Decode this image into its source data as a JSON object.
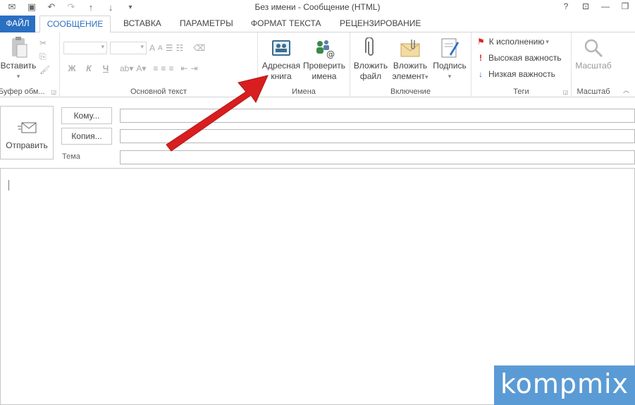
{
  "window": {
    "title": "Без имени - Сообщение (HTML)",
    "controls": [
      "?",
      "⊡",
      "—",
      "❐"
    ]
  },
  "quick_access": [
    "save-icon",
    "undo-icon",
    "redo-icon",
    "up-icon",
    "down-icon",
    "customize-icon"
  ],
  "tabs": [
    {
      "label": "ФАЙЛ"
    },
    {
      "label": "СООБЩЕНИЕ"
    },
    {
      "label": "ВСТАВКА"
    },
    {
      "label": "ПАРАМЕТРЫ"
    },
    {
      "label": "ФОРМАТ ТЕКСТА"
    },
    {
      "label": "РЕЦЕНЗИРОВАНИЕ"
    }
  ],
  "ribbon": {
    "clipboard": {
      "paste_label": "Вставить",
      "group_label": "Буфер обм..."
    },
    "basic_text": {
      "group_label": "Основной текст",
      "bold": "Ж",
      "italic": "К",
      "underline": "Ч"
    },
    "names": {
      "address_book_line1": "Адресная",
      "address_book_line2": "книга",
      "check_names_line1": "Проверить",
      "check_names_line2": "имена",
      "group_label": "Имена"
    },
    "include": {
      "attach_file_line1": "Вложить",
      "attach_file_line2": "файл",
      "attach_item_line1": "Вложить",
      "attach_item_line2": "элемент",
      "signature_label": "Подпись",
      "group_label": "Включение"
    },
    "tags": {
      "follow_up": "К исполнению",
      "high_importance": "Высокая важность",
      "low_importance": "Низкая важность",
      "group_label": "Теги"
    },
    "zoom": {
      "zoom_label": "Масштаб",
      "group_label": "Масштаб"
    }
  },
  "compose": {
    "send_label": "Отправить",
    "to_label": "Кому...",
    "cc_label": "Копия...",
    "subject_label": "Тема",
    "to_value": "",
    "cc_value": "",
    "subject_value": "",
    "body_value": ""
  },
  "watermark": {
    "text": "kompmix"
  },
  "colors": {
    "accent": "#2b6fc2",
    "arrow": "#d81e1e",
    "watermark_bg": "#5b9bd5"
  }
}
